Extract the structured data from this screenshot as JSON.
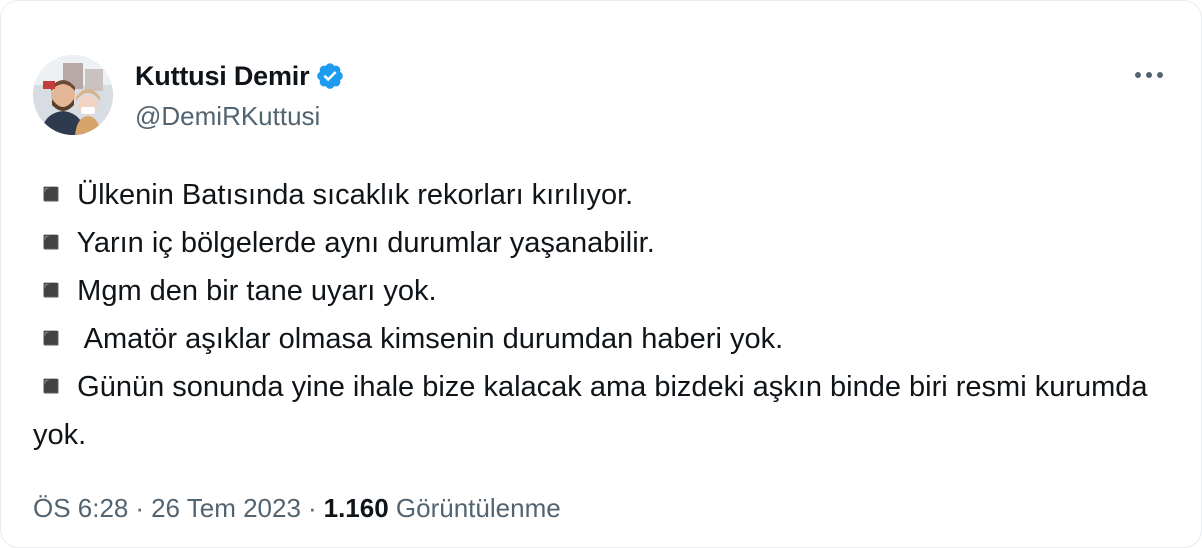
{
  "author": {
    "display_name": "Kuttusi Demir",
    "handle": "@DemiRKuttusi",
    "verified": true,
    "avatar": "profile-photo"
  },
  "menu": {
    "icon": "more-horizontal-icon"
  },
  "tweet": {
    "lines": [
      "◾️ Ülkenin Batısında sıcaklık rekorları kırılıyor.",
      "◾️ Yarın iç bölgelerde aynı durumlar yaşanabilir.",
      "◾️ Mgm den bir tane uyarı yok.",
      "◾️  Amatör aşıklar olmasa kimsenin durumdan haberi yok.",
      "◾️ Günün sonunda yine ihale bize kalacak ama bizdeki aşkın binde biri resmi kurumda yok."
    ]
  },
  "meta": {
    "time": "ÖS 6:28",
    "separator": "·",
    "date": "26 Tem 2023",
    "views_count": "1.160",
    "views_label": "Görüntülenme"
  },
  "colors": {
    "text_primary": "#0f1419",
    "text_secondary": "#536471",
    "verified_blue": "#1d9bf0"
  }
}
